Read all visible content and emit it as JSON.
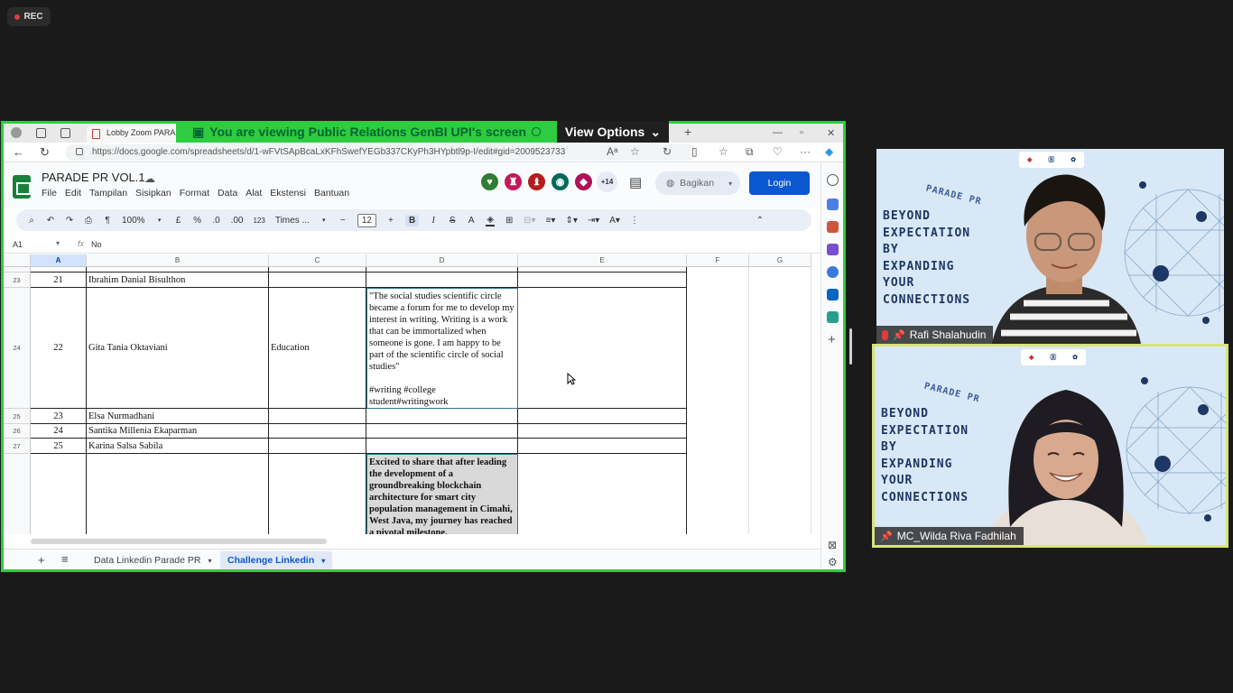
{
  "rec_label": "REC",
  "banner": {
    "text": "You are viewing  Public Relations GenBI UPI's screen",
    "view_options": "View Options"
  },
  "browser": {
    "tab_title": "Lobby Zoom PARADE",
    "url": "https://docs.google.com/spreadsheets/d/1-wFVtSApBcaLxKFhSwefYEGb337CKyPh3HYpbtl9p-I/edit#gid=2009523733"
  },
  "sheets": {
    "doc_title": "PARADE PR VOL.1",
    "menu": [
      "File",
      "Edit",
      "Tampilan",
      "Sisipkan",
      "Format",
      "Data",
      "Alat",
      "Ekstensi",
      "Bantuan"
    ],
    "avatar_extra": "+14",
    "share_label": "Bagikan",
    "login_label": "Login",
    "toolbar": {
      "zoom": "100%",
      "currency": "£",
      "percent": "%",
      "dec_less": ".0",
      "dec_more": ".00",
      "numfmt": "123",
      "font": "Times ...",
      "font_size": "12"
    },
    "formula_bar": {
      "cell_ref": "A1",
      "fx": "fx",
      "value": "No"
    },
    "columns": [
      "A",
      "B",
      "C",
      "D",
      "E",
      "F",
      "G"
    ],
    "rows": [
      {
        "row": "23",
        "no": "21",
        "name": "Ibrahim Danial Bisulthon",
        "category": "",
        "post": ""
      },
      {
        "row": "24",
        "no": "22",
        "name": "Gita Tania Oktaviani",
        "category": "Education",
        "post": "\"The social studies scientific circle became a forum for me to develop my interest in writing. Writing is a work that can be immortalized when someone is gone. I am happy to be part of the scientific circle of social studies\"\n\n#writing #college student#writingwork"
      },
      {
        "row": "25",
        "no": "23",
        "name": "Elsa Nurmadhani",
        "category": "",
        "post": ""
      },
      {
        "row": "26",
        "no": "24",
        "name": "Santika Millenia Ekaparman",
        "category": "",
        "post": ""
      },
      {
        "row": "27",
        "no": "25",
        "name": "Karina Salsa Sabila",
        "category": "",
        "post": ""
      },
      {
        "row": "",
        "no": "",
        "name": "",
        "category": "",
        "post": "Excited to share that after leading the development of a groundbreaking blockchain architecture for smart city population management in Cimahi, West Java, my journey has reached a pivotal milestone."
      }
    ],
    "sheet_tabs": [
      "Data Linkedin Parade PR",
      "Challenge Linkedin"
    ]
  },
  "participants": [
    {
      "name": "Rafi Shalahudin",
      "muted": true
    },
    {
      "name": "MC_Wilda Riva Fadhilah",
      "muted": false
    }
  ],
  "background_text": {
    "parade": "PARADE PR",
    "lines": [
      "BEYOND",
      "EXPECTATION",
      "BY",
      "EXPANDING",
      "YOUR",
      "CONNECTIONS"
    ]
  },
  "colors": {
    "share_border": "#2ecc40",
    "speaker_border": "#d7e37a",
    "login_blue": "#0b57d0"
  }
}
